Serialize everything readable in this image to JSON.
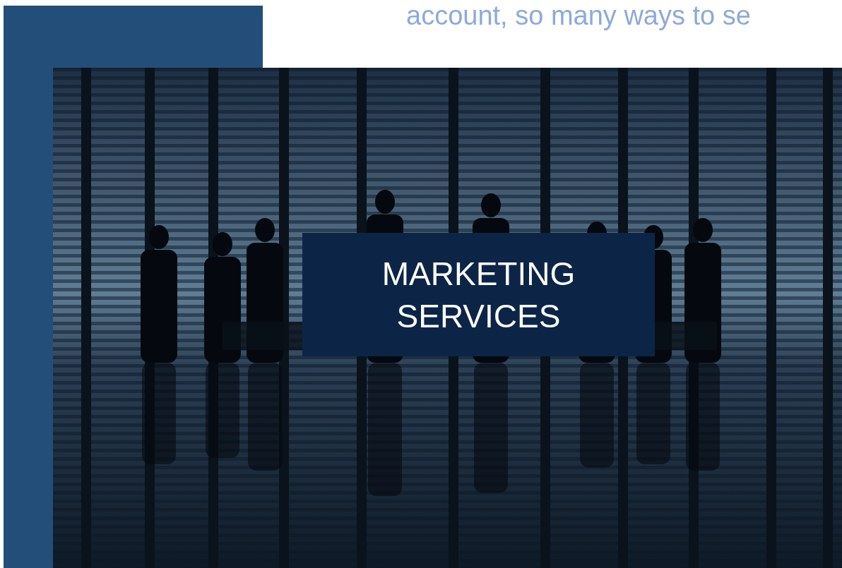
{
  "heading": {
    "text": "account, so many ways to se"
  },
  "hero": {
    "kind": "picture",
    "caption": "MARKETING SERVICES"
  }
}
